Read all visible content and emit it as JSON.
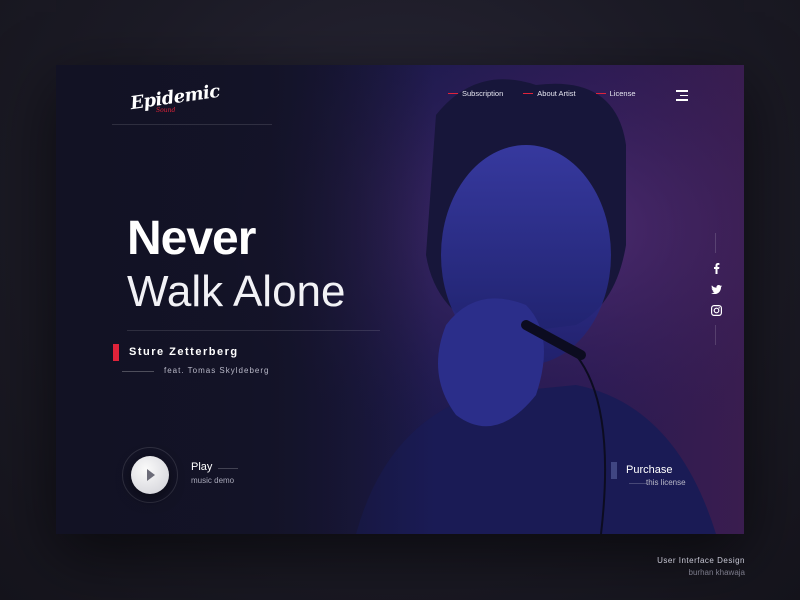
{
  "brand": {
    "logo_text": "Epidemic",
    "logo_sub": "Sound"
  },
  "nav": [
    {
      "label": "Subscription"
    },
    {
      "label": "About Artist"
    },
    {
      "label": "License"
    }
  ],
  "hero": {
    "title_strong": "Never",
    "title_light": "Walk Alone",
    "artist": "Sture Zetterberg",
    "featuring": "feat. Tomas Skyldeberg"
  },
  "player": {
    "label": "Play",
    "sub": "music demo"
  },
  "purchase": {
    "label": "Purchase",
    "sub": "this license"
  },
  "social": [
    "facebook-icon",
    "twitter-icon",
    "instagram-icon"
  ],
  "footer": {
    "line1": "User Interface Design",
    "line2": "burhan khawaja"
  },
  "colors": {
    "accent": "#e0233a",
    "background": "#1c1b26",
    "card": "#171633"
  }
}
